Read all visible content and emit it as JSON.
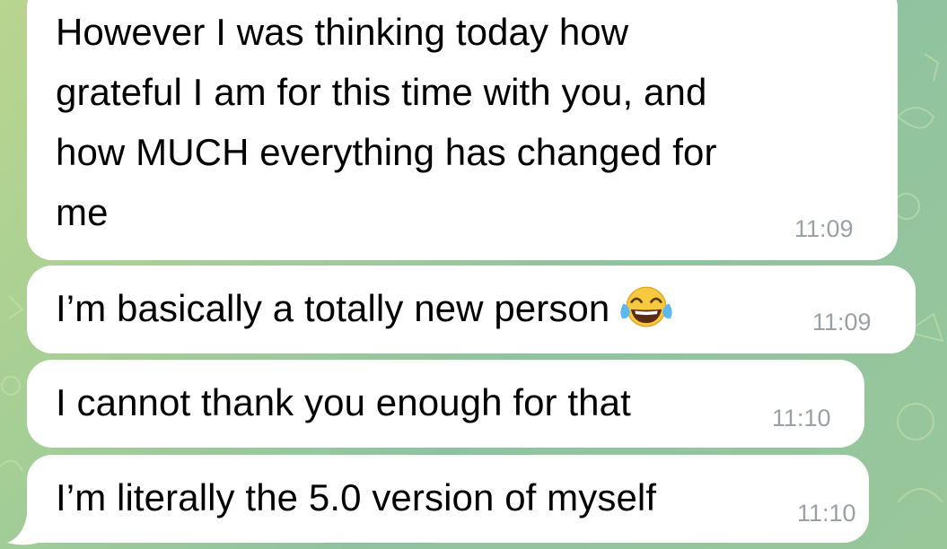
{
  "chat": {
    "background_color": "#a6cf95",
    "bubble_color": "#ffffff",
    "time_color": "#9aa0a6",
    "messages": [
      {
        "lines": [
          "However I was thinking today how",
          "grateful I am for this time with you, and",
          "how MUCH everything has changed for",
          "me"
        ],
        "time": "11:09"
      },
      {
        "text": "I’m basically a totally new person",
        "emoji": "face-with-tears-of-joy-icon",
        "time": "11:09"
      },
      {
        "text": "I cannot thank you enough for that",
        "time": "11:10"
      },
      {
        "text": "I’m literally the 5.0 version of myself",
        "time": "11:10"
      }
    ]
  }
}
